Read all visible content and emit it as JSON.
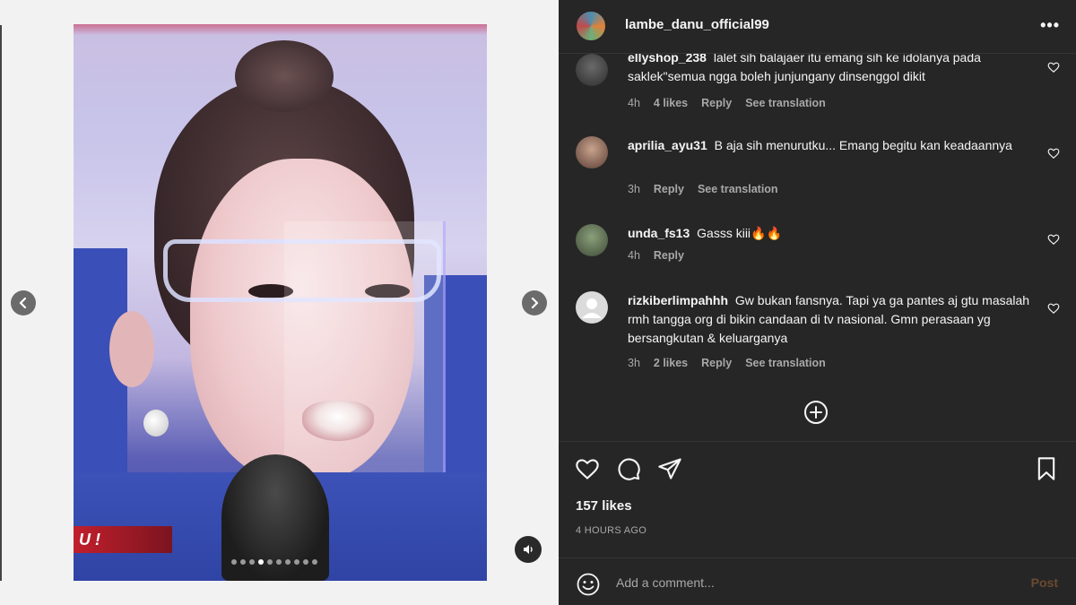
{
  "post": {
    "username": "lambe_danu_official99",
    "more_label": "•••",
    "likes_text": "157 likes",
    "posted_ago": "4 HOURS AGO",
    "banner_text": "U !",
    "carousel_dots": 10,
    "active_dot_index": 3
  },
  "comments": [
    {
      "user": "ellyshop_238",
      "text": "lalet sih balajaer itu emang sih ke idolanya pada saklek\"semua ngga boleh junjungany dinsenggol dikit",
      "time": "4h",
      "likes": "4 likes",
      "reply": "Reply",
      "translate": "See translation"
    },
    {
      "user": "aprilia_ayu31",
      "text": "B aja sih menurutku... Emang begitu kan keadaannya",
      "time": "3h",
      "reply": "Reply",
      "translate": "See translation"
    },
    {
      "user": "unda_fs13",
      "text": "Gasss kiii🔥🔥",
      "time": "4h",
      "reply": "Reply"
    },
    {
      "user": "rizkiberlimpahhh",
      "text": "Gw bukan fansnya. Tapi ya ga pantes aj gtu masalah rmh tangga org di bikin candaan di tv nasional. Gmn perasaan yg bersangkutan & keluarganya",
      "time": "3h",
      "likes": "2 likes",
      "reply": "Reply",
      "translate": "See translation"
    }
  ],
  "composer": {
    "placeholder": "Add a comment...",
    "post_label": "Post"
  },
  "icons": {
    "prev": "chevron-left-icon",
    "next": "chevron-right-icon",
    "sound": "speaker-icon",
    "like": "heart-icon",
    "comment": "comment-icon",
    "share": "paper-plane-icon",
    "save": "bookmark-icon",
    "load_more": "plus-circle-icon",
    "emoji": "smiley-icon"
  },
  "colors": {
    "panel_bg": "#262626",
    "text": "#f5f5f5",
    "muted": "#a8a8a8",
    "post_disabled": "#6b4a2f"
  }
}
